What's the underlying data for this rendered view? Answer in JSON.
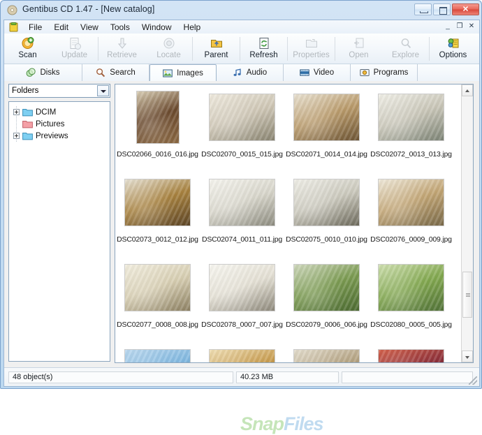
{
  "window": {
    "title": "Gentibus CD 1.47 - [New catalog]",
    "app_icon": "cd-disc-icon",
    "controls": {
      "minimize": "–",
      "maximize": "□",
      "close": "✕"
    },
    "mdi_controls": {
      "minimize": "_",
      "restore": "❐",
      "close": "✕"
    }
  },
  "menu": {
    "icon": "catalog-icon",
    "items": [
      {
        "label": "File"
      },
      {
        "label": "Edit"
      },
      {
        "label": "View"
      },
      {
        "label": "Tools"
      },
      {
        "label": "Window"
      },
      {
        "label": "Help"
      }
    ]
  },
  "toolbar": {
    "buttons": [
      {
        "label": "Scan",
        "icon": "scan-icon",
        "enabled": true
      },
      {
        "label": "Update",
        "icon": "update-icon",
        "enabled": false
      },
      {
        "label": "Retrieve",
        "icon": "retrieve-icon",
        "enabled": false
      },
      {
        "label": "Locate",
        "icon": "locate-icon",
        "enabled": false
      },
      {
        "label": "Parent",
        "icon": "parent-folder-icon",
        "enabled": true
      },
      {
        "label": "Refresh",
        "icon": "refresh-icon",
        "enabled": true
      },
      {
        "label": "Properties",
        "icon": "properties-icon",
        "enabled": false
      },
      {
        "label": "Open",
        "icon": "open-icon",
        "enabled": false
      },
      {
        "label": "Explore",
        "icon": "explore-icon",
        "enabled": false
      },
      {
        "label": "Options",
        "icon": "options-icon",
        "enabled": true
      }
    ]
  },
  "tabs": {
    "active": "Images",
    "items": [
      {
        "label": "Disks",
        "icon": "disks-icon"
      },
      {
        "label": "Search",
        "icon": "magnifier-icon"
      },
      {
        "label": "Images",
        "icon": "images-icon"
      },
      {
        "label": "Audio",
        "icon": "audio-note-icon"
      },
      {
        "label": "Video",
        "icon": "video-film-icon"
      },
      {
        "label": "Programs",
        "icon": "programs-icon"
      }
    ]
  },
  "sidebar": {
    "combo": {
      "value": "Folders",
      "dropdown_icon": "chevron-down-icon"
    },
    "tree": [
      {
        "label": "DCIM",
        "expander": "plus",
        "folder_color": "#6fc8f0"
      },
      {
        "label": "Pictures",
        "expander": "none",
        "folder_color": "#f08a92"
      },
      {
        "label": "Previews",
        "expander": "plus",
        "folder_color": "#6fc8f0"
      }
    ]
  },
  "thumbnails": {
    "rows": [
      [
        {
          "name": "DSC02066_0016_016.jpg",
          "desc": "group of people posing indoors",
          "palette": [
            "#6b4a2e",
            "#d8cdb4",
            "#8c6a44"
          ]
        },
        {
          "name": "DSC02070_0015_015.jpg",
          "desc": "banquet hall with set tables",
          "palette": [
            "#cfc7b6",
            "#efeade",
            "#8a8572"
          ]
        },
        {
          "name": "DSC02071_0014_014.jpg",
          "desc": "dining room with white chairs",
          "palette": [
            "#b99a6a",
            "#e9e2d2",
            "#6e5636"
          ]
        },
        {
          "name": "DSC02072_0013_013.jpg",
          "desc": "patio with white tables",
          "palette": [
            "#c9c6b8",
            "#f0efe7",
            "#7d8476"
          ]
        }
      ],
      [
        {
          "name": "DSC02073_0012_012.jpg",
          "desc": "reception hall interior",
          "palette": [
            "#a8823f",
            "#e6e1d3",
            "#5d4628"
          ]
        },
        {
          "name": "DSC02074_0011_011.jpg",
          "desc": "round table with centerpiece",
          "palette": [
            "#d9d7cc",
            "#f5f4ee",
            "#8d8c80"
          ]
        },
        {
          "name": "DSC02075_0010_010.jpg",
          "desc": "white table setting",
          "palette": [
            "#cbc9bd",
            "#efeee7",
            "#6d6a5c"
          ]
        },
        {
          "name": "DSC02076_0009_009.jpg",
          "desc": "covered terrace with tables",
          "palette": [
            "#c2a574",
            "#efe9da",
            "#7a6a4a"
          ]
        }
      ],
      [
        {
          "name": "DSC02077_0008_008.jpg",
          "desc": "open air dining area",
          "palette": [
            "#d8cfb3",
            "#f2eedf",
            "#8d8163"
          ]
        },
        {
          "name": "DSC02078_0007_007.jpg",
          "desc": "building entrance with doors",
          "palette": [
            "#e4e0d4",
            "#f7f6f0",
            "#8e897c"
          ]
        },
        {
          "name": "DSC02079_0006_006.jpg",
          "desc": "palm lined walkway to building",
          "palette": [
            "#7a9a50",
            "#cfd8bd",
            "#4d6b33"
          ]
        },
        {
          "name": "DSC02080_0005_005.jpg",
          "desc": "garden path with palm trees",
          "palette": [
            "#82a84f",
            "#cfe0b0",
            "#53733a"
          ]
        }
      ],
      [
        {
          "name": "",
          "desc": "palm trees against blue sky",
          "palette": [
            "#7fb7e0",
            "#bcd9ef",
            "#4a7f3e"
          ]
        },
        {
          "name": "",
          "desc": "decorated wall with lights",
          "palette": [
            "#c79b4e",
            "#f0dfb4",
            "#6f5a2e"
          ]
        },
        {
          "name": "",
          "desc": "glass doors of building",
          "palette": [
            "#b3a180",
            "#e3ddcd",
            "#6d6250"
          ]
        },
        {
          "name": "",
          "desc": "bar interior at night",
          "palette": [
            "#8a2f3a",
            "#d4634d",
            "#2f6b3a"
          ]
        }
      ]
    ]
  },
  "scrollbar": {
    "up_arrow": "scroll-up-arrow",
    "down_arrow": "scroll-down-arrow"
  },
  "statusbar": {
    "objects": "48 object(s)",
    "size": "40.23 MB",
    "extra": ""
  },
  "watermark": {
    "prefix": "Snap",
    "suffix": "Files"
  }
}
